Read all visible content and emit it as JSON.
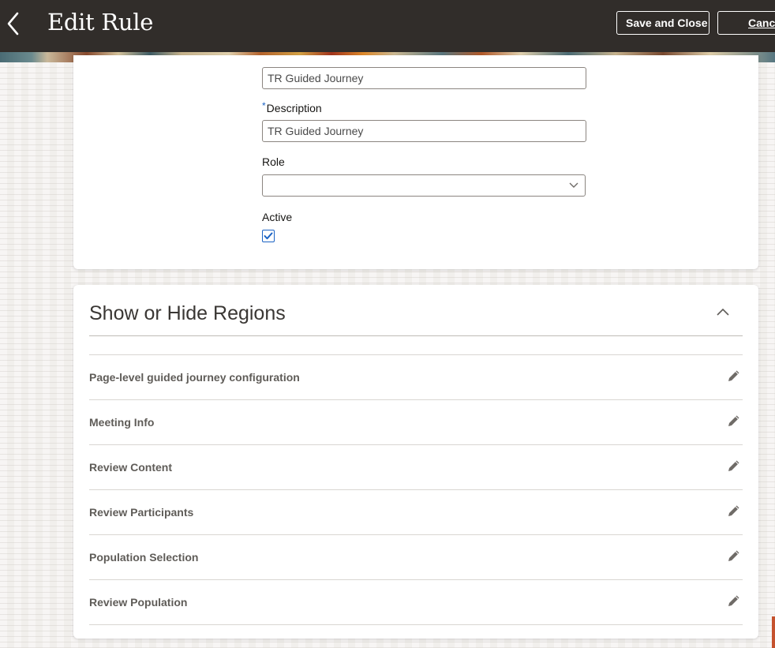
{
  "header": {
    "title": "Edit Rule",
    "save_label": "Save and Close",
    "cancel_label": "Cancel",
    "back_icon": "chevron-left-icon",
    "background_color": "#312d2a"
  },
  "form": {
    "name_value": "TR Guided Journey",
    "description": {
      "required_marker": "*",
      "label": "Description",
      "value": "TR Guided Journey"
    },
    "role": {
      "label": "Role",
      "value": "",
      "icon": "chevron-down-icon"
    },
    "active": {
      "label": "Active",
      "checked": true
    }
  },
  "regions": {
    "title": "Show or Hide Regions",
    "collapse_icon": "chevron-up-icon",
    "edit_icon": "pencil-icon",
    "items": [
      {
        "label": "Page-level guided journey configuration"
      },
      {
        "label": "Meeting Info"
      },
      {
        "label": "Review Content"
      },
      {
        "label": "Review Participants"
      },
      {
        "label": "Population Selection"
      },
      {
        "label": "Review Population"
      }
    ]
  },
  "colors": {
    "accent": "#1b63c4",
    "header": "#312d2a"
  }
}
